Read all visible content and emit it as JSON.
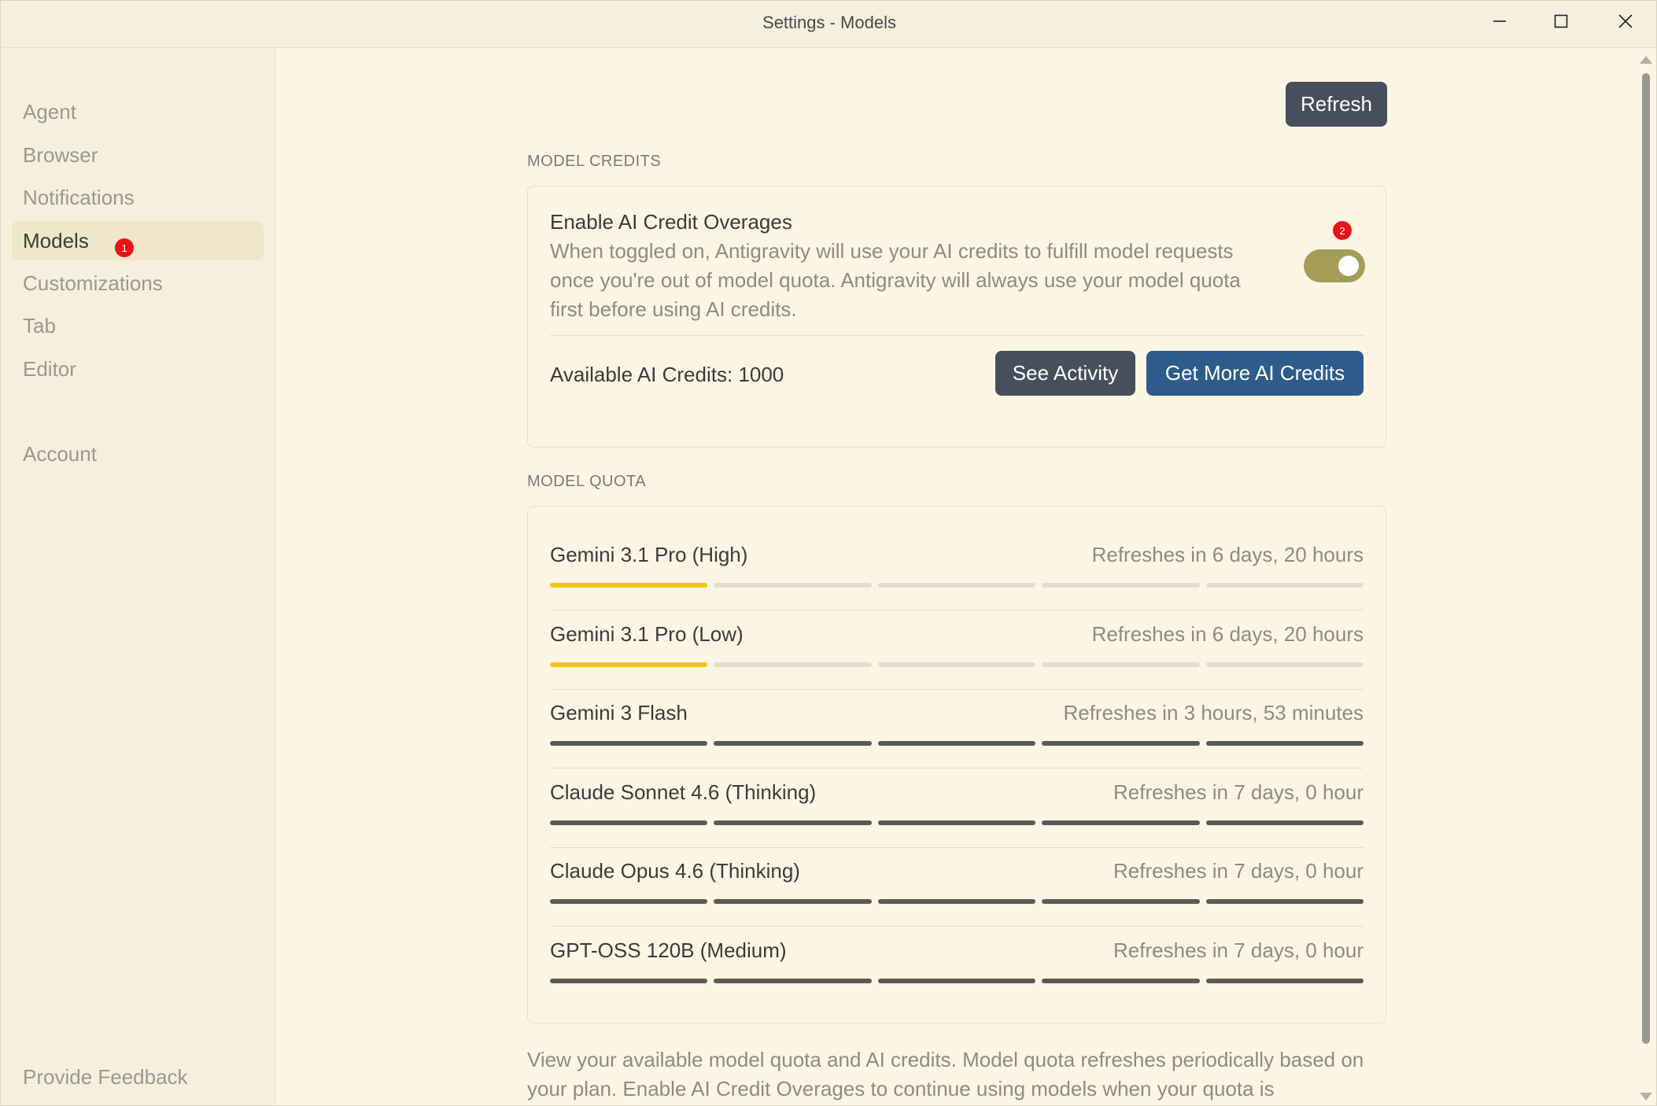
{
  "window": {
    "title": "Settings - Models"
  },
  "sidebar": {
    "items": [
      {
        "label": "Agent"
      },
      {
        "label": "Browser"
      },
      {
        "label": "Notifications"
      },
      {
        "label": "Models",
        "active": true,
        "badge": "1"
      },
      {
        "label": "Customizations"
      },
      {
        "label": "Tab"
      },
      {
        "label": "Editor"
      },
      {
        "label": "Account"
      }
    ],
    "feedback_label": "Provide Feedback"
  },
  "main": {
    "refresh_label": "Refresh",
    "credits_section": {
      "heading": "MODEL CREDITS",
      "overage_title": "Enable AI Credit Overages",
      "overage_desc": "When toggled on, Antigravity will use your AI credits to fulfill model requests once you're out of model quota. Antigravity will always use your model quota first before using AI credits.",
      "toggle_on": true,
      "toggle_badge": "2",
      "available_credits": "Available AI Credits: 1000",
      "see_activity_label": "See Activity",
      "get_more_label": "Get More AI Credits"
    },
    "quota_section": {
      "heading": "MODEL QUOTA",
      "models": [
        {
          "name": "Gemini 3.1 Pro (High)",
          "refresh": "Refreshes in 6 days, 20 hours",
          "quota_fraction": 0.2,
          "status": "low"
        },
        {
          "name": "Gemini 3.1 Pro (Low)",
          "refresh": "Refreshes in 6 days, 20 hours",
          "quota_fraction": 0.2,
          "status": "low"
        },
        {
          "name": "Gemini 3 Flash",
          "refresh": "Refreshes in 3 hours, 53 minutes",
          "quota_fraction": 1.0,
          "status": "full"
        },
        {
          "name": "Claude Sonnet 4.6 (Thinking)",
          "refresh": "Refreshes in 7 days, 0 hour",
          "quota_fraction": 1.0,
          "status": "full"
        },
        {
          "name": "Claude Opus 4.6 (Thinking)",
          "refresh": "Refreshes in 7 days, 0 hour",
          "quota_fraction": 1.0,
          "status": "full"
        },
        {
          "name": "GPT-OSS 120B (Medium)",
          "refresh": "Refreshes in 7 days, 0 hour",
          "quota_fraction": 1.0,
          "status": "full"
        }
      ]
    },
    "footer_note": "View your available model quota and AI credits. Model quota refreshes periodically based on your plan. Enable AI Credit Overages to continue using models when your quota is"
  },
  "colors": {
    "accent_blue": "#2e5c8a",
    "dark_button": "#474e5c",
    "toggle_on": "#a59c57",
    "quota_low": "#f2c31b",
    "quota_full": "#5a5a5a",
    "badge": "#e8141a"
  }
}
